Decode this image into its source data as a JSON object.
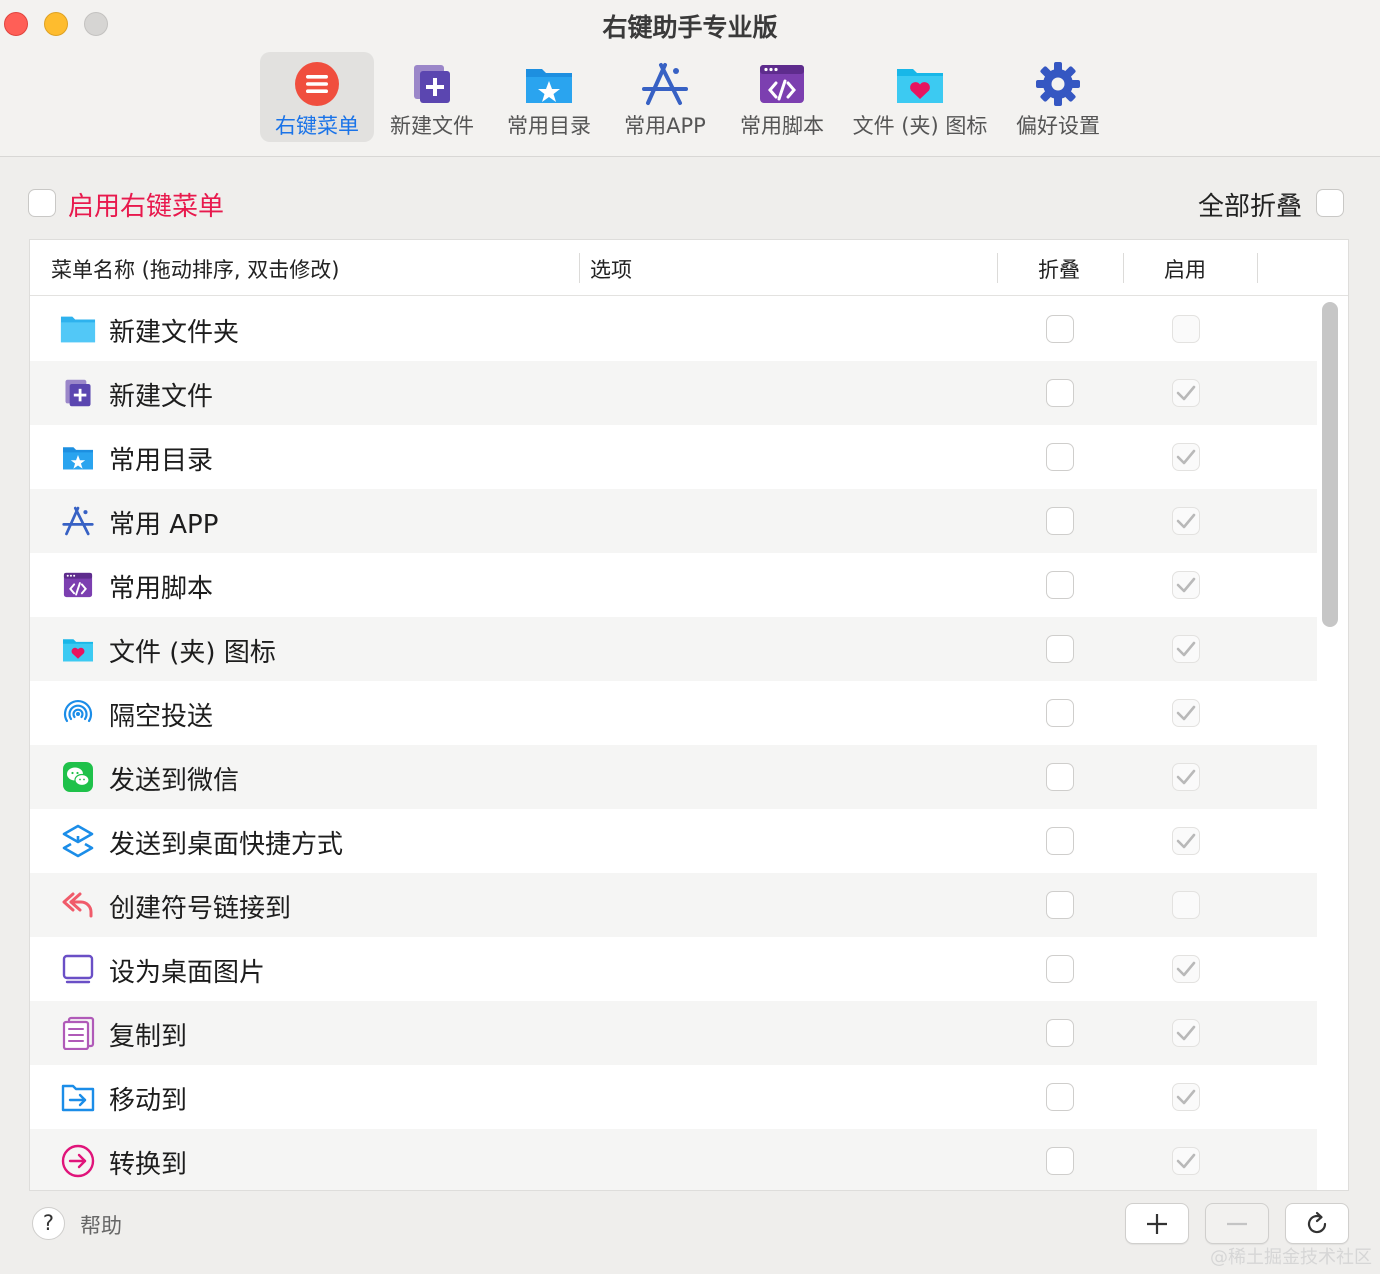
{
  "window": {
    "title": "右键助手专业版"
  },
  "toolbar": {
    "items": [
      {
        "label": "右键菜单",
        "icon": "context-menu-icon",
        "active": true
      },
      {
        "label": "新建文件",
        "icon": "new-file-icon"
      },
      {
        "label": "常用目录",
        "icon": "favorite-folder-icon"
      },
      {
        "label": "常用APP",
        "icon": "app-store-icon"
      },
      {
        "label": "常用脚本",
        "icon": "script-icon"
      },
      {
        "label": "文件 (夹) 图标",
        "icon": "heart-folder-icon"
      },
      {
        "label": "偏好设置",
        "icon": "gear-icon"
      }
    ]
  },
  "options": {
    "enable_label": "启用右键菜单",
    "enable_checked": false,
    "fold_all_label": "全部折叠",
    "fold_all_checked": false
  },
  "table": {
    "columns": [
      "菜单名称 (拖动排序, 双击修改)",
      "选项",
      "折叠",
      "启用"
    ],
    "rows": [
      {
        "name": "新建文件夹",
        "icon": "folder-icon",
        "fold": false,
        "enabled": false
      },
      {
        "name": "新建文件",
        "icon": "new-file-icon",
        "fold": false,
        "enabled": true
      },
      {
        "name": "常用目录",
        "icon": "favorite-folder-icon",
        "fold": false,
        "enabled": true
      },
      {
        "name": "常用 APP",
        "icon": "app-store-icon",
        "fold": false,
        "enabled": true
      },
      {
        "name": "常用脚本",
        "icon": "script-icon",
        "fold": false,
        "enabled": true
      },
      {
        "name": "文件 (夹) 图标",
        "icon": "heart-folder-icon",
        "fold": false,
        "enabled": true
      },
      {
        "name": "隔空投送",
        "icon": "airdrop-icon",
        "fold": false,
        "enabled": true
      },
      {
        "name": "发送到微信",
        "icon": "wechat-icon",
        "fold": false,
        "enabled": true
      },
      {
        "name": "发送到桌面快捷方式",
        "icon": "shortcut-icon",
        "fold": false,
        "enabled": true
      },
      {
        "name": "创建符号链接到",
        "icon": "symlink-icon",
        "fold": false,
        "enabled": false
      },
      {
        "name": "设为桌面图片",
        "icon": "desktop-picture-icon",
        "fold": false,
        "enabled": true
      },
      {
        "name": "复制到",
        "icon": "copy-to-icon",
        "fold": false,
        "enabled": true
      },
      {
        "name": "移动到",
        "icon": "move-to-icon",
        "fold": false,
        "enabled": true
      },
      {
        "name": "转换到",
        "icon": "convert-to-icon",
        "fold": false,
        "enabled": true
      }
    ]
  },
  "footer": {
    "help_symbol": "?",
    "help_label": "帮助",
    "add_icon": "plus-icon",
    "remove_icon": "minus-icon",
    "refresh_icon": "refresh-icon"
  },
  "watermark": "@稀土掘金技术社区",
  "colors": {
    "accent": "#1a73e8",
    "enable_label": "#e8194d",
    "menu_icon": "#f04e3e"
  }
}
